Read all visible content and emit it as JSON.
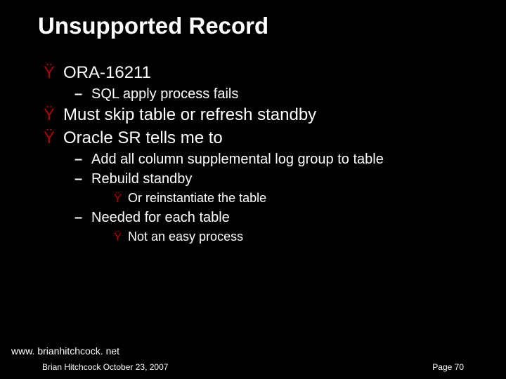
{
  "title": "Unsupported Record",
  "bullets": {
    "b1": "ORA-16211",
    "b1_1": "SQL apply process fails",
    "b2": "Must skip table or refresh standby",
    "b3": "Oracle SR tells me to",
    "b3_1": "Add all column supplemental log group to table",
    "b3_2": "Rebuild standby",
    "b3_2_1": "Or reinstantiate the table",
    "b3_3": "Needed for each table",
    "b3_3_1": "Not an easy process"
  },
  "footer": {
    "url": "www. brianhitchcock. net",
    "author_date": "Brian Hitchcock   October 23, 2007",
    "page": "Page 70"
  },
  "glyphs": {
    "y": "Ÿ",
    "dash": "–"
  }
}
